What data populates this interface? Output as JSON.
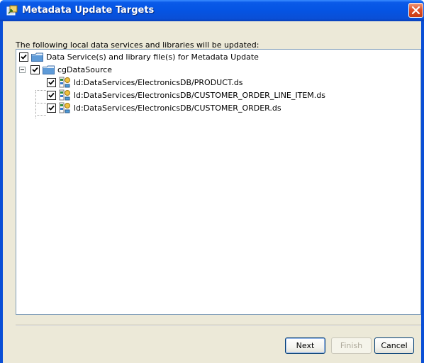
{
  "window": {
    "title": "Metadata Update Targets"
  },
  "dialog": {
    "caption": "The following local data services and libraries will be updated:"
  },
  "tree": {
    "root": {
      "label": "Data Service(s) and library file(s) for Metadata Update",
      "checked": true
    },
    "folder": {
      "label": "cgDataSource",
      "checked": true,
      "expanded": true
    },
    "items": [
      {
        "label": "ld:DataServices/ElectronicsDB/PRODUCT.ds",
        "checked": true
      },
      {
        "label": "ld:DataServices/ElectronicsDB/CUSTOMER_ORDER_LINE_ITEM.ds",
        "checked": true
      },
      {
        "label": "ld:DataServices/ElectronicsDB/CUSTOMER_ORDER.ds",
        "checked": true
      }
    ]
  },
  "buttons": {
    "next": "Next",
    "finish": "Finish",
    "cancel": "Cancel"
  },
  "icons": {
    "title": "dialog-sync-icon",
    "close": "close-icon",
    "folder": "folder-icon",
    "dataservice": "data-service-file-icon",
    "checkbox": "checkmark-icon",
    "collapse": "minus-expander-icon"
  },
  "colors": {
    "titlebar": "#0a4fd6",
    "close": "#e0512a",
    "dialog_bg": "#ece9d8",
    "tree_border": "#7f9db9",
    "folder": "#5e9bd8"
  }
}
